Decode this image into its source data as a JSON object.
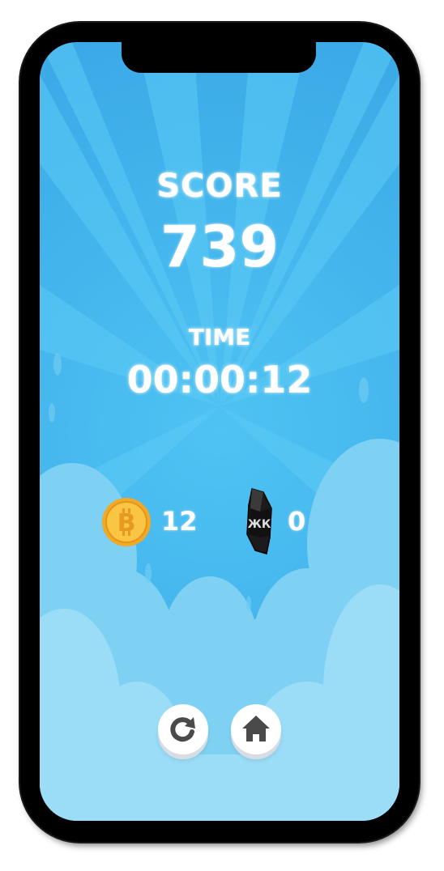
{
  "score": {
    "label": "SCORE",
    "value": "739"
  },
  "time": {
    "label": "TIME",
    "value": "00:00:12"
  },
  "counters": {
    "coins": "12",
    "gems": "0"
  },
  "icons": {
    "coin": "bitcoin-coin-icon",
    "gem": "black-crystal-icon",
    "replay": "replay-icon",
    "home": "home-icon"
  },
  "colors": {
    "sky": "#43b4ec",
    "cloud": "#8fd3f4",
    "coin": "#f5b730",
    "text": "#ffffff"
  }
}
